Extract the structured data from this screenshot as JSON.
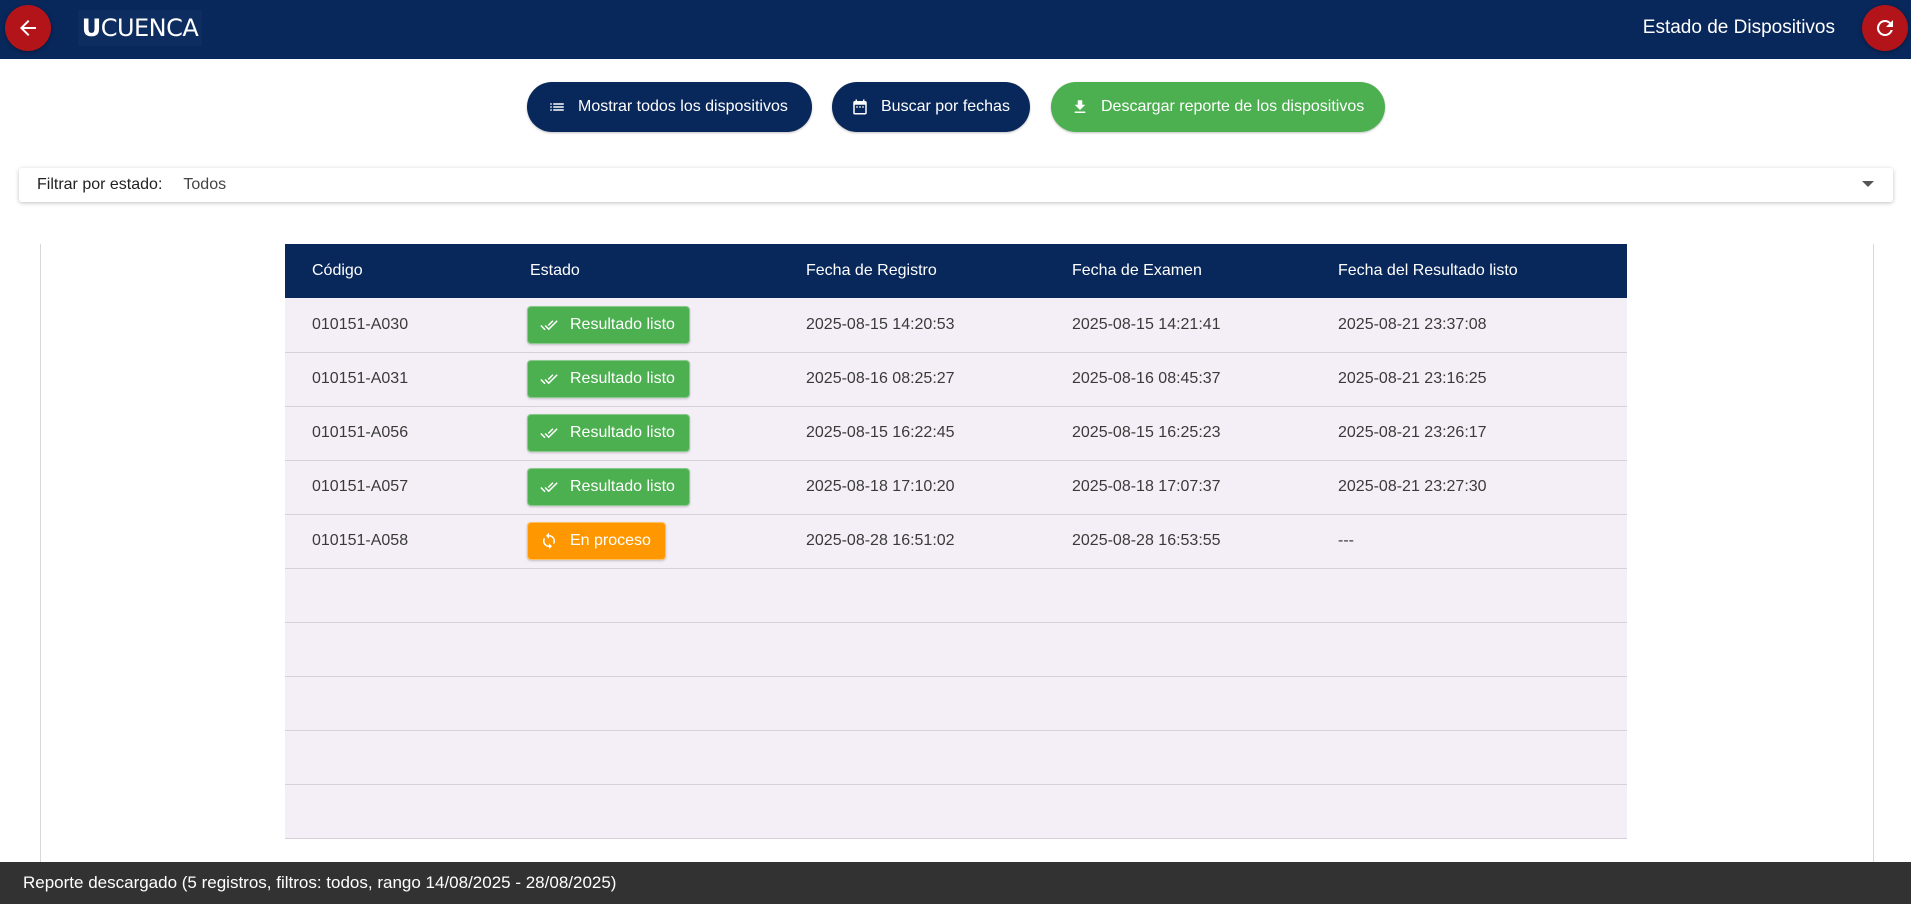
{
  "header": {
    "title": "Estado de Dispositivos",
    "logo_bold": "U",
    "logo_text": "CUENCA",
    "colors": {
      "bar": "#08275a",
      "round_buttons": "#b3141a"
    },
    "back_icon": "arrow-left-icon",
    "refresh_icon": "refresh-icon"
  },
  "actions": {
    "show_all": {
      "label": "Mostrar todos los dispositivos",
      "icon": "list-icon",
      "color": "#08275a"
    },
    "search_dates": {
      "label": "Buscar por fechas",
      "icon": "calendar-icon",
      "color": "#08275a"
    },
    "download": {
      "label": "Descargar reporte de los dispositivos",
      "icon": "download-icon",
      "color": "#4caf50"
    }
  },
  "filter": {
    "label": "Filtrar por estado:",
    "selected": "Todos",
    "icon": "chevron-down-icon"
  },
  "table": {
    "columns": [
      "Código",
      "Estado",
      "Fecha de Registro",
      "Fecha de Examen",
      "Fecha del Resultado listo"
    ],
    "rows": [
      {
        "codigo": "010151-A030",
        "estado": "Resultado listo",
        "estado_tipo": "done",
        "registro": "2025-08-15 14:20:53",
        "examen": "2025-08-15 14:21:41",
        "resultado": "2025-08-21 23:37:08"
      },
      {
        "codigo": "010151-A031",
        "estado": "Resultado listo",
        "estado_tipo": "done",
        "registro": "2025-08-16 08:25:27",
        "examen": "2025-08-16 08:45:37",
        "resultado": "2025-08-21 23:16:25"
      },
      {
        "codigo": "010151-A056",
        "estado": "Resultado listo",
        "estado_tipo": "done",
        "registro": "2025-08-15 16:22:45",
        "examen": "2025-08-15 16:25:23",
        "resultado": "2025-08-21 23:26:17"
      },
      {
        "codigo": "010151-A057",
        "estado": "Resultado listo",
        "estado_tipo": "done",
        "registro": "2025-08-18 17:10:20",
        "examen": "2025-08-18 17:07:37",
        "resultado": "2025-08-21 23:27:30"
      },
      {
        "codigo": "010151-A058",
        "estado": "En proceso",
        "estado_tipo": "proc",
        "registro": "2025-08-28 16:51:02",
        "examen": "2025-08-28 16:53:55",
        "resultado": "---"
      }
    ],
    "status_colors": {
      "done": "#4caf50",
      "proc": "#ff9800"
    },
    "status_icons": {
      "done": "double-check-icon",
      "proc": "sync-icon"
    }
  },
  "snackbar": {
    "message": "Reporte descargado (5 registros, filtros: todos, rango 14/08/2025 - 28/08/2025)"
  }
}
